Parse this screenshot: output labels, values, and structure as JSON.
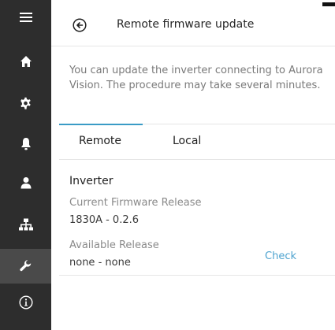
{
  "sidebar": {
    "items": [
      {
        "icon": "menu-icon"
      },
      {
        "icon": "home-icon"
      },
      {
        "icon": "gear-icon"
      },
      {
        "icon": "bell-icon"
      },
      {
        "icon": "user-icon"
      },
      {
        "icon": "network-icon"
      },
      {
        "icon": "wrench-icon",
        "active": true
      },
      {
        "icon": "info-icon"
      }
    ],
    "background": "#2d2d2d",
    "active_background": "#4a4a4a"
  },
  "header": {
    "title": "Remote firmware update"
  },
  "description": "You can update the inverter connecting to Aurora Vision. The procedure may take several minutes.",
  "tabs": {
    "items": [
      "Remote",
      "Local"
    ],
    "active": "Remote",
    "accent": "#3a9bc6"
  },
  "inverter": {
    "title": "Inverter",
    "current_label": "Current Firmware Release",
    "current_value": "1830A - 0.2.6",
    "available_label": "Available Release",
    "available_value": "none - none",
    "check_label": "Check",
    "link_color": "#4ea3cf"
  }
}
